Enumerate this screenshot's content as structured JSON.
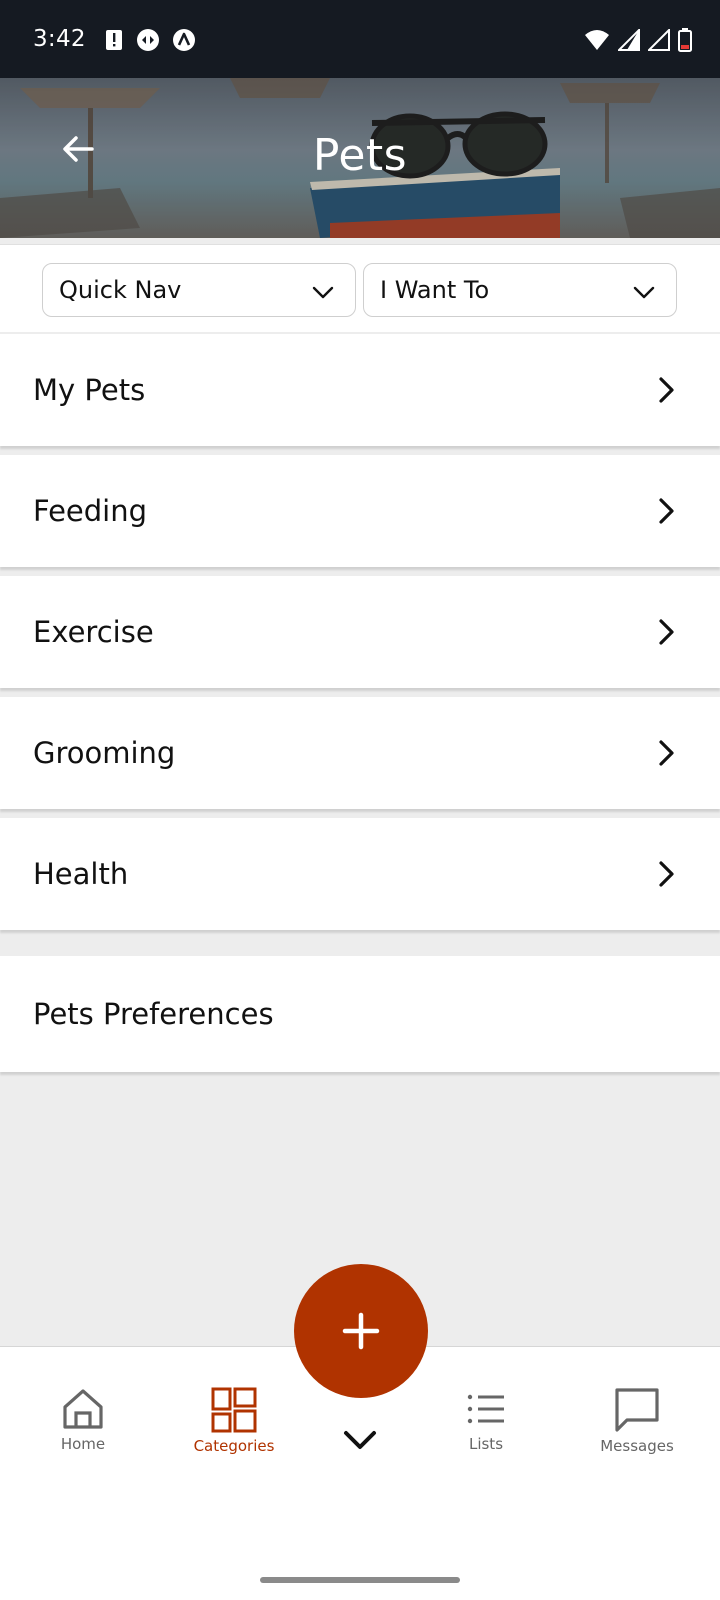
{
  "status_bar": {
    "time": "3:42",
    "left_icons": [
      "alert-icon",
      "cast-icon",
      "nav-icon"
    ],
    "right_icons": [
      "wifi-icon",
      "signal-icon",
      "signal-icon",
      "battery-icon"
    ]
  },
  "header": {
    "title": "Pets",
    "back_icon": "arrow-left-icon"
  },
  "dropdowns": {
    "quick_nav": "Quick Nav",
    "i_want_to": "I Want To"
  },
  "menu": {
    "items": [
      {
        "label": "My Pets"
      },
      {
        "label": "Feeding"
      },
      {
        "label": "Exercise"
      },
      {
        "label": "Grooming"
      },
      {
        "label": "Health"
      }
    ],
    "preferences": "Pets Preferences"
  },
  "bottom_nav": {
    "home": "Home",
    "categories": "Categories",
    "lists": "Lists",
    "messages": "Messages"
  },
  "colors": {
    "accent": "#b03300",
    "status_bar": "#151a22"
  }
}
